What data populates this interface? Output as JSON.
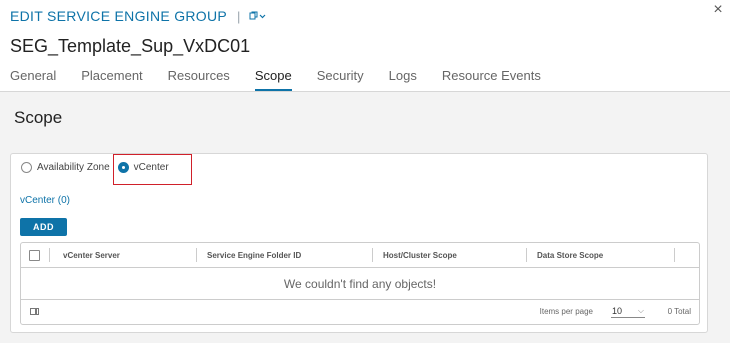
{
  "header": {
    "title": "EDIT SERVICE ENGINE GROUP",
    "separator": "|",
    "close_glyph": "×",
    "title_icon": "copy-chevron-icon",
    "close_icon": "close-icon"
  },
  "seg_name": "SEG_Template_Sup_VxDC01",
  "tabs": [
    {
      "label": "General",
      "active": false
    },
    {
      "label": "Placement",
      "active": false
    },
    {
      "label": "Resources",
      "active": false
    },
    {
      "label": "Scope",
      "active": true
    },
    {
      "label": "Security",
      "active": false
    },
    {
      "label": "Logs",
      "active": false
    },
    {
      "label": "Resource Events",
      "active": false
    }
  ],
  "scope": {
    "heading": "Scope",
    "radios": [
      {
        "label": "Availability Zone",
        "checked": false
      },
      {
        "label": "vCenter",
        "checked": true
      }
    ],
    "vcenter_label": "vCenter (0)",
    "add_label": "ADD"
  },
  "grid": {
    "columns": [
      "vCenter Server",
      "Service Engine Folder ID",
      "Host/Cluster Scope",
      "Data Store Scope"
    ],
    "empty_message": "We couldn't find any objects!",
    "items_per_page_label": "Items per page",
    "items_per_page_value": "10",
    "total": "0 Total"
  },
  "colors": {
    "accent": "#0e73a8",
    "highlight": "#d0202a"
  }
}
